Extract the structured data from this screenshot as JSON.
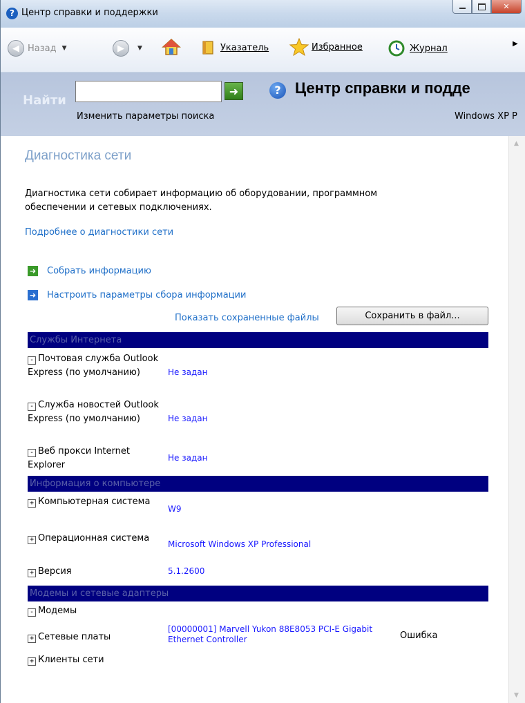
{
  "window": {
    "title": "Центр справки и поддержки"
  },
  "toolbar": {
    "back_label": "Назад",
    "index_label": "Указатель",
    "favorites_label": "Избранное",
    "history_label": "Журнал"
  },
  "search": {
    "find_label": "Найти",
    "value": "",
    "change_options_link": "Изменить параметры поиска",
    "header_title": "Центр справки и подде",
    "product_text": "Windows XP P"
  },
  "page": {
    "title": "Диагностика сети",
    "description": "Диагностика сети собирает информацию об оборудовании, программном обеспечении и сетевых подключениях.",
    "more_link": "Подробнее о диагностики сети",
    "collect_link": "Собрать информацию",
    "configure_link": "Настроить параметры сбора информации",
    "show_saved_link": "Показать сохраненные файлы",
    "save_button": "Сохранить в файл..."
  },
  "sections": {
    "internet": {
      "header": "Службы Интернета",
      "rows": [
        {
          "toggle": "-",
          "label": "Почтовая служба Outlook Express (по умолчанию)",
          "value": "Не задан"
        },
        {
          "toggle": "-",
          "label": "Служба новостей Outlook Express (по умолчанию)",
          "value": "Не задан"
        },
        {
          "toggle": "-",
          "label": "Веб прокси Internet Explorer",
          "value": "Не задан"
        }
      ]
    },
    "computer": {
      "header": "Информация о компьютере",
      "rows": [
        {
          "toggle": "+",
          "label": "Компьютерная система",
          "value": "W9"
        },
        {
          "toggle": "+",
          "label": "Операционная система",
          "value": "Microsoft Windows XP Professional"
        },
        {
          "toggle": "+",
          "label": "Версия",
          "value": "5.1.2600"
        }
      ]
    },
    "modems": {
      "header": "Модемы и сетевые адаптеры",
      "rows": [
        {
          "toggle": "-",
          "label": "Модемы",
          "value": ""
        },
        {
          "toggle": "+",
          "label": "Сетевые платы",
          "value": "[00000001] Marvell Yukon 88E8053 PCI-E Gigabit Ethernet Controller",
          "status": "Ошибка"
        },
        {
          "toggle": "+",
          "label": "Клиенты сети",
          "value": ""
        }
      ]
    }
  },
  "colors": {
    "section_bg": "#000080",
    "link": "#1f6fc8",
    "value_text": "#1a1aff",
    "title_text": "#7da0c9"
  }
}
